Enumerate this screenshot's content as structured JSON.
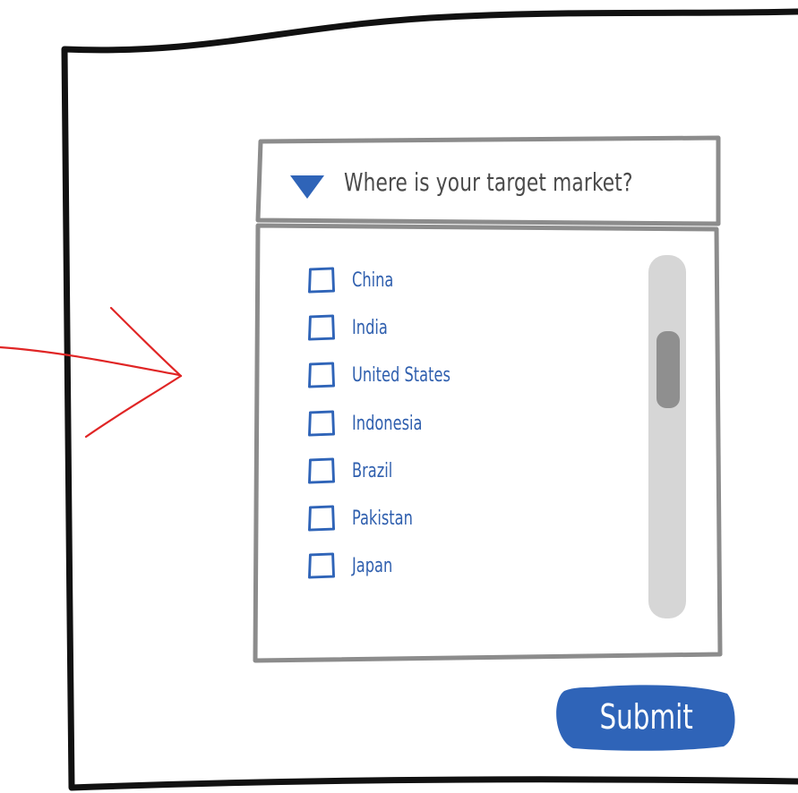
{
  "dropdown": {
    "question": "Where is your target market?",
    "expanded": true,
    "options": [
      {
        "label": "China",
        "checked": false
      },
      {
        "label": "India",
        "checked": false
      },
      {
        "label": "United States",
        "checked": false
      },
      {
        "label": "Indonesia",
        "checked": false
      },
      {
        "label": "Brazil",
        "checked": false
      },
      {
        "label": "Pakistan",
        "checked": false
      },
      {
        "label": "Japan",
        "checked": false
      }
    ]
  },
  "submit": {
    "label": "Submit"
  },
  "colors": {
    "accent": "#2f64b8",
    "frame": "#111111",
    "panel_border": "#8c8c8c",
    "scroll_track": "#d6d6d6",
    "scroll_thumb": "#8f8f8f",
    "annotation_arrow": "#e02525"
  },
  "icons": {
    "expand": "triangle-down-icon",
    "annotation": "arrow-right-icon"
  }
}
